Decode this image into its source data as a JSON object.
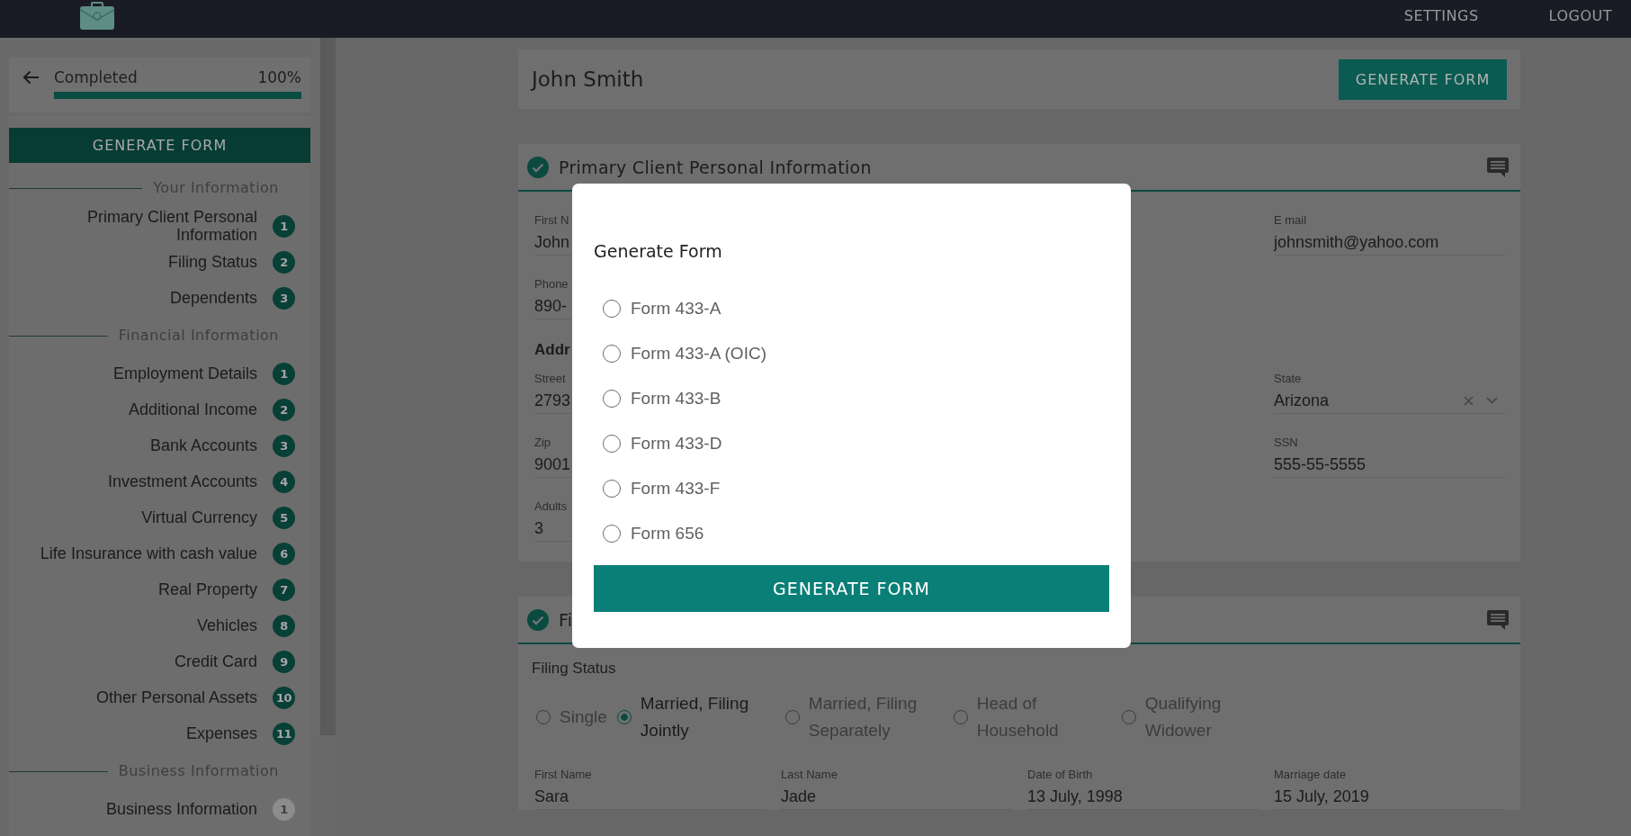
{
  "top_bar": {
    "links": [
      {
        "label": "SETTINGS"
      },
      {
        "label": "LOGOUT"
      }
    ]
  },
  "sidebar": {
    "progress": {
      "label": "Completed",
      "reading": "100%",
      "level": 1
    },
    "button": "GENERATE FORM",
    "sections": [
      {
        "title": "Your Information",
        "items": [
          {
            "label": "Primary Client Personal Information",
            "badge": "1",
            "complete": true
          },
          {
            "label": "Filing Status",
            "badge": "2",
            "complete": true
          },
          {
            "label": "Dependents",
            "badge": "3",
            "complete": true
          }
        ]
      },
      {
        "title": "Financial Information",
        "items": [
          {
            "label": "Employment Details",
            "badge": "1",
            "complete": true
          },
          {
            "label": "Additional Income",
            "badge": "2",
            "complete": true
          },
          {
            "label": "Bank Accounts",
            "badge": "3",
            "complete": true
          },
          {
            "label": "Investment Accounts",
            "badge": "4",
            "complete": true
          },
          {
            "label": "Virtual Currency",
            "badge": "5",
            "complete": true
          },
          {
            "label": "Life Insurance with cash value",
            "badge": "6",
            "complete": true
          },
          {
            "label": "Real Property",
            "badge": "7",
            "complete": true
          },
          {
            "label": "Vehicles",
            "badge": "8",
            "complete": true
          },
          {
            "label": "Credit Card",
            "badge": "9",
            "complete": true
          },
          {
            "label": "Other Personal Assets",
            "badge": "10",
            "complete": true
          },
          {
            "label": "Expenses",
            "badge": "11",
            "complete": true
          }
        ]
      },
      {
        "title": "Business Information",
        "items": [
          {
            "label": "Business Information",
            "badge": "1",
            "complete": false
          }
        ]
      }
    ]
  },
  "header": {
    "client_name": "John Smith",
    "button": "GENERATE FORM"
  },
  "primary_section": {
    "title": "Primary Client Personal Information",
    "complete": true,
    "rows": [
      {
        "kind": "fields",
        "left": {
          "label": "First N",
          "value": "John",
          "kind": "text"
        },
        "right": {
          "label": "E mail",
          "value": "johnsmith@yahoo.com",
          "kind": "text"
        }
      },
      {
        "kind": "fields",
        "left": {
          "label": "Phone",
          "value": "890-",
          "kind": "text"
        }
      },
      {
        "kind": "heading",
        "text": "Addr"
      },
      {
        "kind": "fields",
        "left": {
          "label": "Street",
          "value": "2793",
          "kind": "text"
        },
        "right": {
          "label": "State",
          "value": "Arizona",
          "kind": "select"
        }
      },
      {
        "kind": "fields",
        "left": {
          "label": "Zip",
          "value": "9001",
          "kind": "text"
        },
        "right": {
          "label": "SSN",
          "value": "555-55-5555",
          "kind": "text"
        }
      },
      {
        "kind": "fields",
        "left": {
          "label": "Adults",
          "value": "3",
          "kind": "text"
        }
      }
    ]
  },
  "filing_section": {
    "title": "Fi",
    "complete": true,
    "filing_status": {
      "label": "Filing Status",
      "options": [
        {
          "label": "Single",
          "selected": false
        },
        {
          "label": "Married, Filing Jointly",
          "selected": true
        },
        {
          "label": "Married, Filing Separately",
          "selected": false
        },
        {
          "label": "Head of Household",
          "selected": false
        },
        {
          "label": "Qualifying Widower",
          "selected": false
        }
      ]
    },
    "fields": [
      {
        "label": "First Name",
        "value": "Sara"
      },
      {
        "label": "Last Name",
        "value": "Jade"
      },
      {
        "label": "Date of Birth",
        "value": "13 July, 1998"
      },
      {
        "label": "Marriage date",
        "value": "15 July, 2019"
      }
    ]
  },
  "modal": {
    "title": "Generate Form",
    "options": [
      {
        "label": "Form 433-A",
        "selected": false
      },
      {
        "label": "Form 433-A (OIC)",
        "selected": false
      },
      {
        "label": "Form 433-B",
        "selected": false
      },
      {
        "label": "Form 433-D",
        "selected": false
      },
      {
        "label": "Form 433-F",
        "selected": false
      },
      {
        "label": "Form 656",
        "selected": false
      }
    ],
    "button": "GENERATE FORM"
  }
}
